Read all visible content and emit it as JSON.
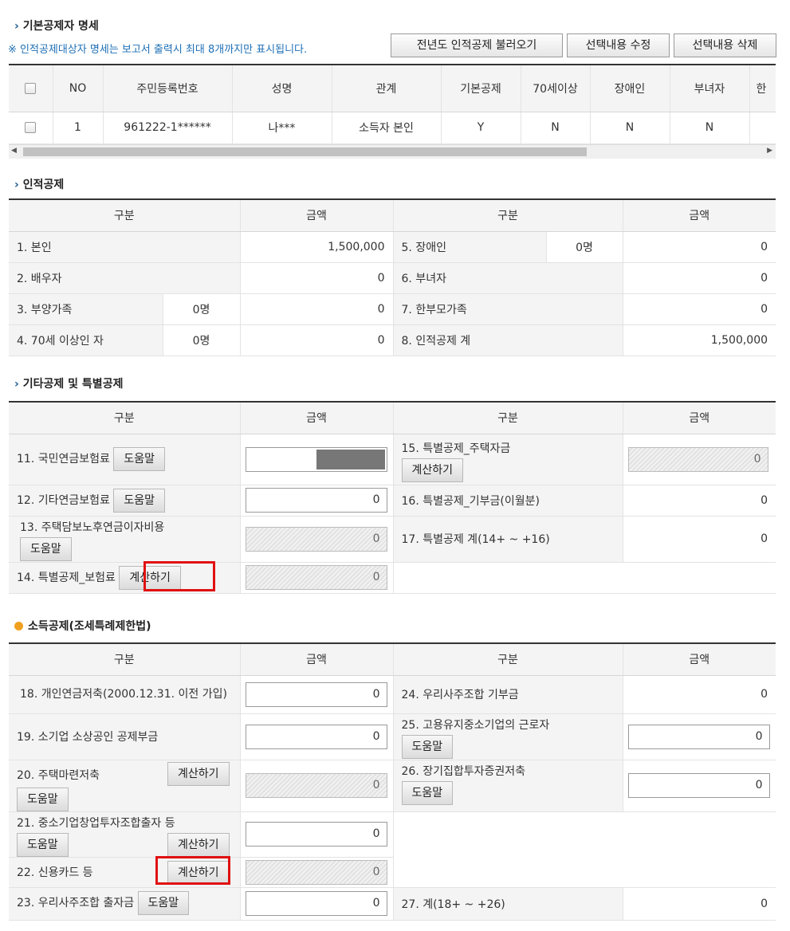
{
  "sections": {
    "basic": "기본공제자 명세",
    "personal": "인적공제",
    "other": "기타공제 및 특별공제",
    "income": "소득공제(조세특례제한법)"
  },
  "notice": "※ 인적공제대상자 명세는 보고서 출력시 최대 8개까지만 표시됩니다.",
  "buttons": {
    "load_prev": "전년도 인적공제 불러오기",
    "edit_selected": "선택내용 수정",
    "delete_selected": "선택내용 삭제",
    "help": "도움말",
    "calc": "계산하기"
  },
  "dependents": {
    "headers": [
      "NO",
      "주민등록번호",
      "성명",
      "관계",
      "기본공제",
      "70세이상",
      "장애인",
      "부녀자",
      "한"
    ],
    "rows": [
      [
        "1",
        "961222-1******",
        "나***",
        "소득자 본인",
        "Y",
        "N",
        "N",
        "N"
      ]
    ]
  },
  "col": {
    "category": "구분",
    "amount": "금액"
  },
  "personal": {
    "r1": {
      "label": "1. 본인",
      "amount": "1,500,000"
    },
    "r2": {
      "label": "2. 배우자",
      "amount": "0"
    },
    "r3": {
      "label": "3. 부양가족",
      "count": "0명",
      "amount": "0"
    },
    "r4": {
      "label": "4. 70세 이상인 자",
      "count": "0명",
      "amount": "0"
    },
    "r5": {
      "label": "5. 장애인",
      "count": "0명",
      "amount": "0"
    },
    "r6": {
      "label": "6. 부녀자",
      "amount": "0"
    },
    "r7": {
      "label": "7. 한부모가족",
      "amount": "0"
    },
    "r8": {
      "label": "8. 인적공제 계",
      "amount": "1,500,000"
    }
  },
  "other": {
    "r11": {
      "label": "11. 국민연금보험료"
    },
    "r12": {
      "label": "12. 기타연금보험료",
      "value": "0"
    },
    "r13": {
      "label": "13. 주택담보노후연금이자비용",
      "value": "0"
    },
    "r14": {
      "label": "14. 특별공제_보험료",
      "value": "0"
    },
    "r15": {
      "label": "15. 특별공제_주택자금",
      "value": "0"
    },
    "r16": {
      "label": "16. 특별공제_기부금(이월분)",
      "amount": "0"
    },
    "r17": {
      "label": "17. 특별공제 계(14+ ~ +16)",
      "amount": "0"
    }
  },
  "income": {
    "r18": {
      "label": "18. 개인연금저축(2000.12.31. 이전 가입)",
      "value": "0"
    },
    "r19": {
      "label": "19. 소기업 소상공인 공제부금",
      "value": "0"
    },
    "r20": {
      "label": "20. 주택마련저축",
      "value": "0"
    },
    "r21": {
      "label": "21. 중소기업창업투자조합출자 등",
      "value": "0"
    },
    "r22": {
      "label": "22. 신용카드 등",
      "value": "0"
    },
    "r23": {
      "label": "23. 우리사주조합 출자금",
      "value": "0"
    },
    "r24": {
      "label": "24. 우리사주조합 기부금",
      "amount": "0"
    },
    "r25": {
      "label": "25. 고용유지중소기업의 근로자",
      "value": "0"
    },
    "r26": {
      "label": "26. 장기집합투자증권저축",
      "value": "0"
    },
    "r27": {
      "label": "27. 계(18+ ~ +26)",
      "amount": "0"
    }
  },
  "colors": {
    "accent": "#1e5a8a",
    "highlight": "#e01010",
    "bullet": "#f0a020"
  }
}
